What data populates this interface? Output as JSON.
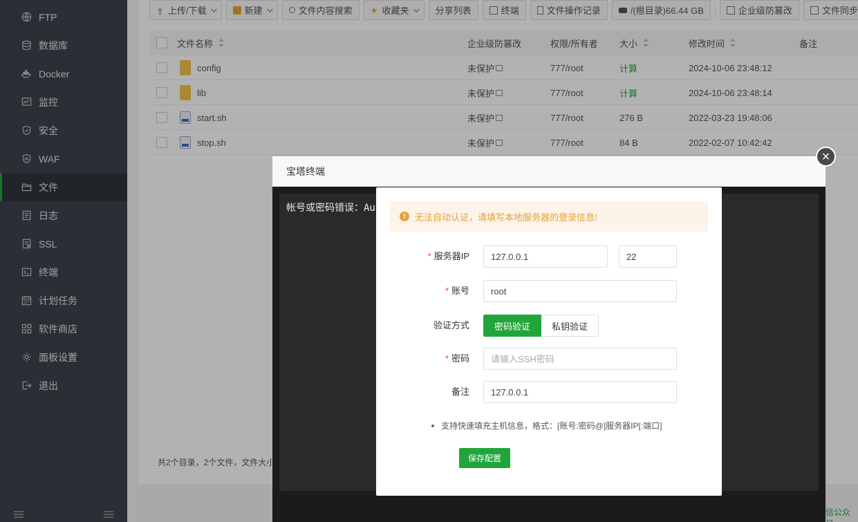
{
  "sidebar": {
    "items": [
      {
        "label": "FTP",
        "icon": "globe-icon"
      },
      {
        "label": "数据库",
        "icon": "database-icon"
      },
      {
        "label": "Docker",
        "icon": "docker-icon"
      },
      {
        "label": "监控",
        "icon": "monitor-icon"
      },
      {
        "label": "安全",
        "icon": "shield-icon"
      },
      {
        "label": "WAF",
        "icon": "waf-shield-icon"
      },
      {
        "label": "文件",
        "icon": "folder-icon"
      },
      {
        "label": "日志",
        "icon": "log-icon"
      },
      {
        "label": "SSL",
        "icon": "ssl-icon"
      },
      {
        "label": "终端",
        "icon": "terminal-icon"
      },
      {
        "label": "计划任务",
        "icon": "calendar-icon"
      },
      {
        "label": "软件商店",
        "icon": "grid-icon"
      },
      {
        "label": "面板设置",
        "icon": "gear-icon"
      },
      {
        "label": "退出",
        "icon": "logout-icon"
      }
    ],
    "active_label": "文件"
  },
  "toolbar": {
    "upload": "上传/下载",
    "new": "新建",
    "search_content": "文件内容搜索",
    "favorites": "收藏夹",
    "share_list": "分享列表",
    "terminal": "终端",
    "file_ops_log": "文件操作记录",
    "disk": "/(根目录)66.44 GB",
    "tamper": "企业级防篡改",
    "sync": "文件同步"
  },
  "table": {
    "headers": {
      "name": "文件名称",
      "tamper": "企业级防篡改",
      "perm": "权限/所有者",
      "size": "大小",
      "mtime": "修改时间",
      "note": "备注"
    },
    "rows": [
      {
        "name": "config",
        "type": "folder",
        "tamper": "未保护",
        "perm": "777/root",
        "size": "计算",
        "mtime": "2024-10-06 23:48:12"
      },
      {
        "name": "lib",
        "type": "folder",
        "tamper": "未保护",
        "perm": "777/root",
        "size": "计算",
        "mtime": "2024-10-06 23:48:14"
      },
      {
        "name": "start.sh",
        "type": "shell",
        "tamper": "未保护",
        "perm": "777/root",
        "size": "276 B",
        "mtime": "2022-03-23 19:48:06"
      },
      {
        "name": "stop.sh",
        "type": "shell",
        "tamper": "未保护",
        "perm": "777/root",
        "size": "84 B",
        "mtime": "2022-02-07 10:42:42"
      }
    ],
    "footer": "共2个目录，2个文件，文件大小"
  },
  "corner_text": "信公众号",
  "terminal_window": {
    "title": "宝塔终端",
    "output": "帐号或密码错误：Aut"
  },
  "dialog": {
    "alert": "无法自动认证，请填写本地服务器的登录信息!",
    "server_ip_label": "服务器IP",
    "server_ip": "127.0.0.1",
    "port": "22",
    "account_label": "账号",
    "account": "root",
    "auth_label": "验证方式",
    "auth_password": "密码验证",
    "auth_key": "私钥验证",
    "password_label": "密码",
    "password_placeholder": "请输入SSH密码",
    "note_label": "备注",
    "note": "127.0.0.1",
    "tip": "支持快速填充主机信息，格式：[账号:密码@]服务器IP[:端口]",
    "save": "保存配置"
  },
  "colors": {
    "accent": "#20a53a",
    "sidebar_bg": "#3c444d",
    "warning": "#e6a23c"
  }
}
